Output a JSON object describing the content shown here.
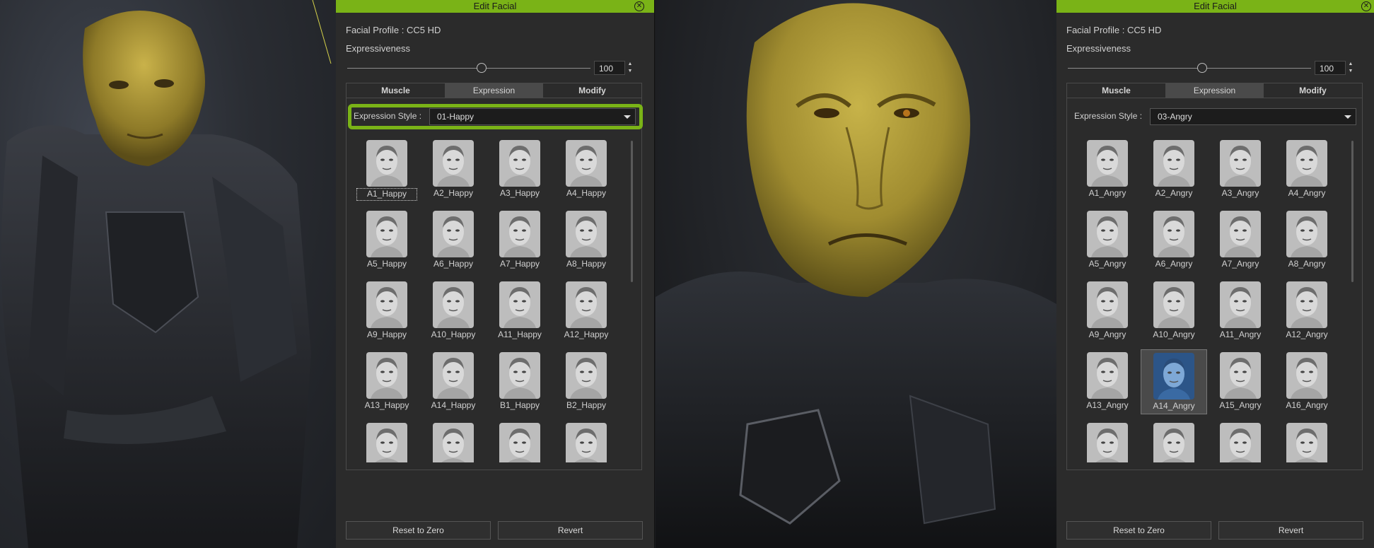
{
  "left_panel": {
    "title": "Edit Facial",
    "profile_label": "Facial Profile : CC5 HD",
    "expressiveness_label": "Expressiveness",
    "expressiveness_value": "100",
    "expressiveness_fraction": 0.55,
    "tabs": [
      "Muscle",
      "Expression",
      "Modify"
    ],
    "active_tab": "Expression",
    "style_label": "Expression Style :",
    "style_value": "01-Happy",
    "items": [
      "A1_Happy",
      "A2_Happy",
      "A3_Happy",
      "A4_Happy",
      "A5_Happy",
      "A6_Happy",
      "A7_Happy",
      "A8_Happy",
      "A9_Happy",
      "A10_Happy",
      "A11_Happy",
      "A12_Happy",
      "A13_Happy",
      "A14_Happy",
      "B1_Happy",
      "B2_Happy",
      "",
      "",
      "",
      ""
    ],
    "focused_item": "A1_Happy",
    "reset_label": "Reset to Zero",
    "revert_label": "Revert"
  },
  "right_panel": {
    "title": "Edit Facial",
    "profile_label": "Facial Profile : CC5 HD",
    "expressiveness_label": "Expressiveness",
    "expressiveness_value": "100",
    "expressiveness_fraction": 0.55,
    "tabs": [
      "Muscle",
      "Expression",
      "Modify"
    ],
    "active_tab": "Expression",
    "style_label": "Expression Style :",
    "style_value": "03-Angry",
    "items": [
      "A1_Angry",
      "A2_Angry",
      "A3_Angry",
      "A4_Angry",
      "A5_Angry",
      "A6_Angry",
      "A7_Angry",
      "A8_Angry",
      "A9_Angry",
      "A10_Angry",
      "A11_Angry",
      "A12_Angry",
      "A13_Angry",
      "A14_Angry",
      "A15_Angry",
      "A16_Angry",
      "",
      "",
      "",
      ""
    ],
    "selected_item": "A14_Angry",
    "reset_label": "Reset to Zero",
    "revert_label": "Revert"
  },
  "colors": {
    "accent_green": "#7ab317",
    "panel_bg": "#2b2b2b",
    "selected_thumb": "#3f6fa6"
  }
}
